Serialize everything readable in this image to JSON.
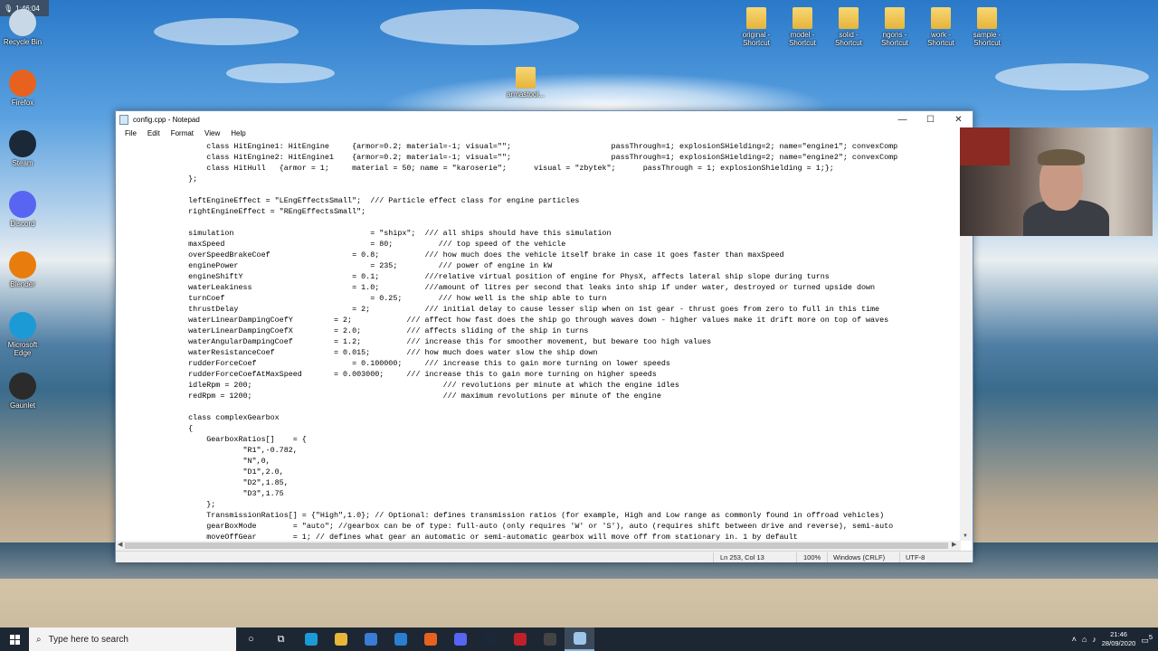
{
  "recording": {
    "time": "1:46:04"
  },
  "desktop": {
    "left_icons": [
      {
        "label": "Recycle Bin",
        "color": "#c9d8e6"
      },
      {
        "label": "Firefox",
        "color": "#e8621f"
      },
      {
        "label": "Steam",
        "color": "#1b2838"
      },
      {
        "label": "Discord",
        "color": "#5865f2"
      },
      {
        "label": "Blender",
        "color": "#e87d0d"
      },
      {
        "label": "Microsoft Edge",
        "color": "#1c9ad6"
      },
      {
        "label": "Gaunlet",
        "color": "#2b2b2b"
      }
    ],
    "top_icons": [
      {
        "label": "original - Shortcut"
      },
      {
        "label": "model - Shortcut"
      },
      {
        "label": "solid - Shortcut"
      },
      {
        "label": "ngons - Shortcut"
      },
      {
        "label": "work - Shortcut"
      },
      {
        "label": "sample - Shortcut"
      }
    ],
    "mid_icon": {
      "label": "armastool..."
    }
  },
  "notepad": {
    "title": "config.cpp - Notepad",
    "menu": [
      "File",
      "Edit",
      "Format",
      "View",
      "Help"
    ],
    "lines": [
      "          class HitEngine1: HitEngine     {armor=0.2; material=-1; visual=\"\";                      passThrough=1; explosionSHielding=2; name=\"engine1\"; convexComp",
      "          class HitEngine2: HitEngine1    {armor=0.2; material=-1; visual=\"\";                      passThrough=1; explosionSHielding=2; name=\"engine2\"; convexComp",
      "          class HitHull   {armor = 1;     material = 50; name = \"karoserie\";      visual = \"zbytek\";      passThrough = 1; explosionShielding = 1;};",
      "      };",
      "",
      "      leftEngineEffect = \"LEngEffectsSmall\";  /// Particle effect class for engine particles",
      "      rightEngineEffect = \"REngEffectsSmall\";",
      "",
      "      simulation                              = \"shipx\";  /// all ships should have this simulation",
      "      maxSpeed                                = 80;          /// top speed of the vehicle",
      "      overSpeedBrakeCoef                  = 0.8;          /// how much does the vehicle itself brake in case it goes faster than maxSpeed",
      "      enginePower                             = 235;         /// power of engine in kW",
      "      engineShiftY                        = 0.1;          ///relative virtual position of engine for PhysX, affects lateral ship slope during turns",
      "      waterLeakiness                      = 1.0;          ///amount of litres per second that leaks into ship if under water, destroyed or turned upside down",
      "      turnCoef                                = 0.25;        /// how well is the ship able to turn",
      "      thrustDelay                         = 2;            /// initial delay to cause lesser slip when on 1st gear - thrust goes from zero to full in this time",
      "      waterLinearDampingCoefY         = 2;            /// affect how fast does the ship go through waves down - higher values make it drift more on top of waves",
      "      waterLinearDampingCoefX         = 2.0;          /// affects sliding of the ship in turns",
      "      waterAngularDampingCoef         = 1.2;          /// increase this for smoother movement, but beware too high values",
      "      waterResistanceCoef             = 0.015;        /// how much does water slow the ship down",
      "      rudderForceCoef                     = 0.100000;     /// increase this to gain more turning on lower speeds",
      "      rudderForceCoefAtMaxSpeed       = 0.003000;     /// increase this to gain more turning on higher speeds",
      "      idleRpm = 200;                                          /// revolutions per minute at which the engine idles",
      "      redRpm = 1200;                                          /// maximum revolutions per minute of the engine",
      "",
      "      class complexGearbox",
      "      {",
      "          GearboxRatios[]    = {",
      "                  \"R1\",-0.782,",
      "                  \"N\",0,",
      "                  \"D1\",2.0,",
      "                  \"D2\",1.85,",
      "                  \"D3\",1.75",
      "          };",
      "          TransmissionRatios[] = {\"High\",1.0}; // Optional: defines transmission ratios (for example, High and Low range as commonly found in offroad vehicles)",
      "          gearBoxMode        = \"auto\"; //gearbox can be of type: full-auto (only requires 'W' or 'S'), auto (requires shift between drive and reverse), semi-auto",
      "          moveOffGear        = 1; // defines what gear an automatic or semi-automatic gearbox will move off from stationary in. 1 by default"
    ],
    "status": {
      "position": "Ln 253, Col 13",
      "zoom": "100%",
      "eol": "Windows (CRLF)",
      "encoding": "UTF-8"
    }
  },
  "taskbar": {
    "search_placeholder": "Type here to search",
    "apps": [
      {
        "name": "cortana-icon",
        "color": "#ffffff",
        "glyph": "○"
      },
      {
        "name": "task-view-icon",
        "color": "#ffffff",
        "glyph": "⧉"
      },
      {
        "name": "edge-icon",
        "color": "#1c9ad6",
        "glyph": ""
      },
      {
        "name": "file-explorer-icon",
        "color": "#e8b739",
        "glyph": ""
      },
      {
        "name": "store-icon",
        "color": "#3a7bd5",
        "glyph": ""
      },
      {
        "name": "mail-icon",
        "color": "#2b7fd3",
        "glyph": ""
      },
      {
        "name": "firefox-icon",
        "color": "#e8621f",
        "glyph": ""
      },
      {
        "name": "discord-icon",
        "color": "#5865f2",
        "glyph": ""
      },
      {
        "name": "steam-icon",
        "color": "#1b2838",
        "glyph": ""
      },
      {
        "name": "app-red-icon",
        "color": "#c0202a",
        "glyph": ""
      },
      {
        "name": "app-dark-icon",
        "color": "#444444",
        "glyph": ""
      },
      {
        "name": "notepad-icon",
        "color": "#9ec6e8",
        "glyph": ""
      }
    ],
    "time": "21:46",
    "date": "28/09/2020",
    "notifications": "5"
  }
}
